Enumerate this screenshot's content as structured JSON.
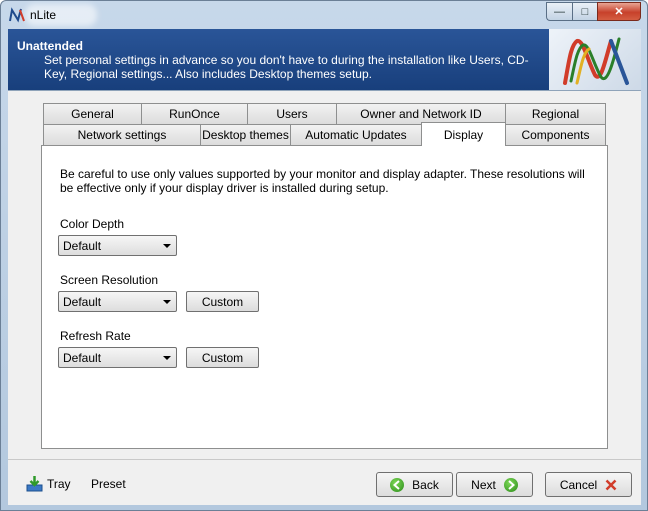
{
  "window": {
    "title": "nLite"
  },
  "header": {
    "title": "Unattended",
    "description": "Set personal settings in advance so you don't have to during the installation like Users, CD-Key, Regional settings... Also includes Desktop themes setup."
  },
  "tabs": {
    "row1": [
      "General",
      "RunOnce",
      "Users",
      "Owner and Network ID",
      "Regional"
    ],
    "row2": [
      "Network settings",
      "Desktop themes",
      "Automatic Updates",
      "Display",
      "Components"
    ],
    "active": "Display"
  },
  "display": {
    "note": "Be careful to use only values supported by your monitor and display adapter. These resolutions will be effective only if your display driver is installed during setup.",
    "color_depth": {
      "label": "Color Depth",
      "value": "Default"
    },
    "screen_resolution": {
      "label": "Screen Resolution",
      "value": "Default",
      "custom_label": "Custom"
    },
    "refresh_rate": {
      "label": "Refresh Rate",
      "value": "Default",
      "custom_label": "Custom"
    }
  },
  "footer": {
    "tray_label": "Tray",
    "preset_label": "Preset",
    "back_label": "Back",
    "next_label": "Next",
    "cancel_label": "Cancel"
  },
  "colors": {
    "header_bg": "#1f4a8c",
    "title_bar": "#c0d4e8",
    "close_red": "#c7412b",
    "nav_green": "#3ba52a"
  },
  "icons": [
    "nlite-logo-icon",
    "minimize-icon",
    "maximize-icon",
    "close-icon",
    "tray-download-icon",
    "back-arrow-icon",
    "next-arrow-icon",
    "cancel-x-icon"
  ]
}
